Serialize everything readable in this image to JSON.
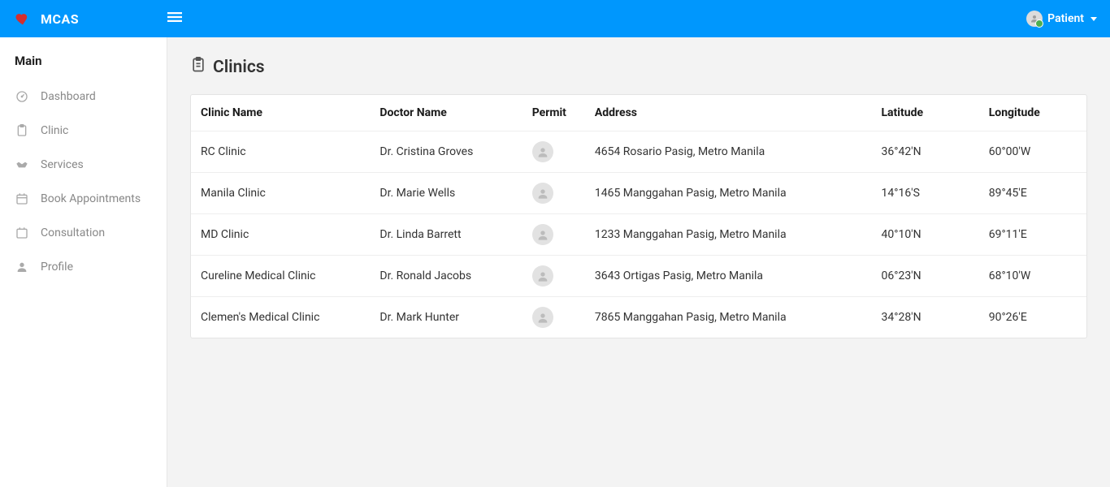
{
  "brand": {
    "name": "MCAS"
  },
  "user": {
    "label": "Patient"
  },
  "sidebar": {
    "sectionTitle": "Main",
    "items": [
      {
        "label": "Dashboard",
        "icon": "dashboard"
      },
      {
        "label": "Clinic",
        "icon": "clipboard"
      },
      {
        "label": "Services",
        "icon": "handshake"
      },
      {
        "label": "Book Appointments",
        "icon": "calendar-alt"
      },
      {
        "label": "Consultation",
        "icon": "calendar"
      },
      {
        "label": "Profile",
        "icon": "user"
      }
    ]
  },
  "page": {
    "title": "Clinics"
  },
  "table": {
    "headers": {
      "name": "Clinic Name",
      "doctor": "Doctor Name",
      "permit": "Permit",
      "address": "Address",
      "latitude": "Latitude",
      "longitude": "Longitude"
    },
    "rows": [
      {
        "name": "RC Clinic",
        "doctor": "Dr. Cristina Groves",
        "address": "4654 Rosario Pasig, Metro Manila",
        "latitude": "36°42'N",
        "longitude": "60°00'W"
      },
      {
        "name": "Manila Clinic",
        "doctor": "Dr. Marie Wells",
        "address": "1465 Manggahan Pasig, Metro Manila",
        "latitude": "14°16'S",
        "longitude": "89°45'E"
      },
      {
        "name": "MD Clinic",
        "doctor": "Dr. Linda Barrett",
        "address": "1233 Manggahan Pasig, Metro Manila",
        "latitude": "40°10'N",
        "longitude": "69°11'E"
      },
      {
        "name": "Cureline Medical Clinic",
        "doctor": "Dr. Ronald Jacobs",
        "address": "3643 Ortigas Pasig, Metro Manila",
        "latitude": "06°23'N",
        "longitude": "68°10'W"
      },
      {
        "name": "Clemen's Medical Clinic",
        "doctor": "Dr. Mark Hunter",
        "address": "7865 Manggahan Pasig, Metro Manila",
        "latitude": "34°28'N",
        "longitude": "90°26'E"
      }
    ]
  }
}
